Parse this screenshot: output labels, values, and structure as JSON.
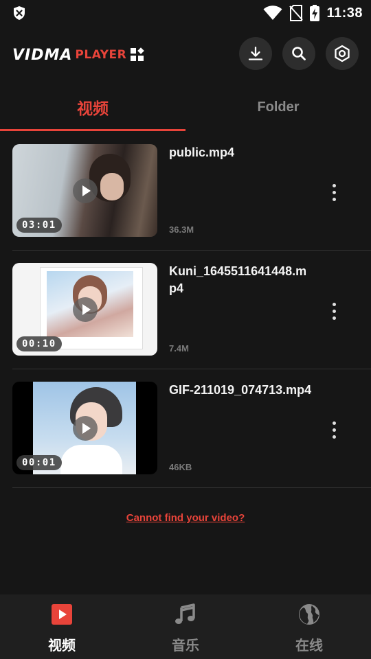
{
  "status_bar": {
    "time": "11:38",
    "icons": [
      "shield-x-icon",
      "wifi-icon",
      "no-sim-icon",
      "battery-charging-icon"
    ]
  },
  "app_bar": {
    "logo_main": "VIDMA",
    "logo_sub": "PLAYER",
    "actions": [
      "download-icon",
      "search-icon",
      "settings-icon"
    ]
  },
  "tabs": [
    {
      "label": "视频",
      "active": true
    },
    {
      "label": "Folder",
      "active": false
    }
  ],
  "videos": [
    {
      "title": "public.mp4",
      "duration": "03:01",
      "size": "36.3M"
    },
    {
      "title": "Kuni_1645511641448.mp4",
      "duration": "00:10",
      "size": "7.4M"
    },
    {
      "title": "GIF-211019_074713.mp4",
      "duration": "00:01",
      "size": "46KB"
    }
  ],
  "help_link": "Cannot find your video?",
  "bottom_nav": [
    {
      "label": "视频",
      "icon": "video-play-icon",
      "active": true
    },
    {
      "label": "音乐",
      "icon": "music-note-icon",
      "active": false
    },
    {
      "label": "在线",
      "icon": "globe-icon",
      "active": false
    }
  ],
  "colors": {
    "background": "#161616",
    "accent": "#e8443a",
    "inactive": "#8a8a8a",
    "nav_background": "#1f1f1f"
  }
}
